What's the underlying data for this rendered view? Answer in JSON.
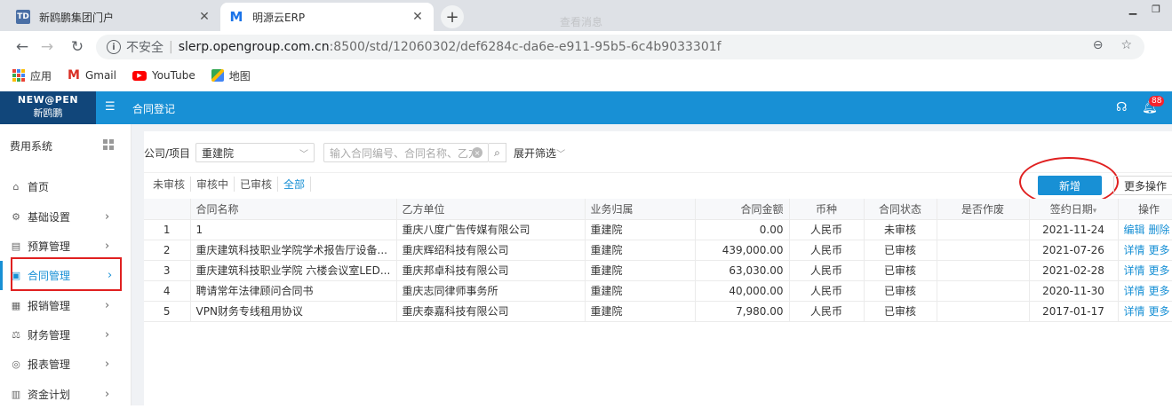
{
  "browser": {
    "tabs": [
      {
        "title": "新鸥鹏集团门户",
        "favicon": "TD"
      },
      {
        "title": "明源云ERP",
        "favicon": "M"
      }
    ],
    "blurred_title": "查看消息",
    "security_label": "不安全",
    "url_host": "slerp.opengroup.com.cn",
    "url_rest": ":8500/std/12060302/def6284c-da6e-e911-95b5-6c4b9033301f",
    "bookmarks": [
      "应用",
      "Gmail",
      "YouTube",
      "地图"
    ]
  },
  "app": {
    "logo_line1": "NEW@PEN",
    "logo_line2": "新鸥鹏",
    "title": "合同登记",
    "notification_count": "88",
    "accent_color": "#1890d5"
  },
  "sidebar": {
    "system_title": "费用系统",
    "items": [
      {
        "label": "首页",
        "icon": "home-icon"
      },
      {
        "label": "基础设置",
        "icon": "gear-icon"
      },
      {
        "label": "预算管理",
        "icon": "budget-icon"
      },
      {
        "label": "合同管理",
        "icon": "contract-icon",
        "active": true
      },
      {
        "label": "报销管理",
        "icon": "reimburse-icon"
      },
      {
        "label": "财务管理",
        "icon": "finance-icon"
      },
      {
        "label": "报表管理",
        "icon": "report-icon"
      },
      {
        "label": "资金计划",
        "icon": "fund-icon"
      }
    ]
  },
  "filters": {
    "company_label": "公司/项目",
    "company_value": "重建院",
    "search_placeholder": "输入合同编号、合同名称、乙方",
    "expand_label": "展开筛选"
  },
  "status_tabs": [
    "未审核",
    "审核中",
    "已审核",
    "全部"
  ],
  "active_status": "全部",
  "actions": {
    "add_label": "新增",
    "more_label": "更多操作"
  },
  "table": {
    "columns": [
      "",
      "合同名称",
      "乙方单位",
      "业务归属",
      "合同金额",
      "币种",
      "合同状态",
      "是否作废",
      "签约日期",
      "操作"
    ],
    "rows": [
      {
        "idx": "1",
        "name": "1",
        "party": "重庆八度广告传媒有限公司",
        "owner": "重建院",
        "amount": "0.00",
        "currency": "人民币",
        "status": "未审核",
        "void": "",
        "date": "2021-11-24",
        "ops": [
          "编辑",
          "删除"
        ]
      },
      {
        "idx": "2",
        "name": "重庆建筑科技职业学院学术报告厅设备...",
        "party": "重庆辉绍科技有限公司",
        "owner": "重建院",
        "amount": "439,000.00",
        "currency": "人民币",
        "status": "已审核",
        "void": "",
        "date": "2021-07-26",
        "ops": [
          "详情",
          "更多"
        ]
      },
      {
        "idx": "3",
        "name": "重庆建筑科技职业学院 六楼会议室LED...",
        "party": "重庆邦卓科技有限公司",
        "owner": "重建院",
        "amount": "63,030.00",
        "currency": "人民币",
        "status": "已审核",
        "void": "",
        "date": "2021-02-28",
        "ops": [
          "详情",
          "更多"
        ]
      },
      {
        "idx": "4",
        "name": "聘请常年法律顾问合同书",
        "party": "重庆志同律师事务所",
        "owner": "重建院",
        "amount": "40,000.00",
        "currency": "人民币",
        "status": "已审核",
        "void": "",
        "date": "2020-11-30",
        "ops": [
          "详情",
          "更多"
        ]
      },
      {
        "idx": "5",
        "name": "VPN财务专线租用协议",
        "party": "重庆泰嘉科技有限公司",
        "owner": "重建院",
        "amount": "7,980.00",
        "currency": "人民币",
        "status": "已审核",
        "void": "",
        "date": "2017-01-17",
        "ops": [
          "详情",
          "更多"
        ]
      }
    ]
  }
}
